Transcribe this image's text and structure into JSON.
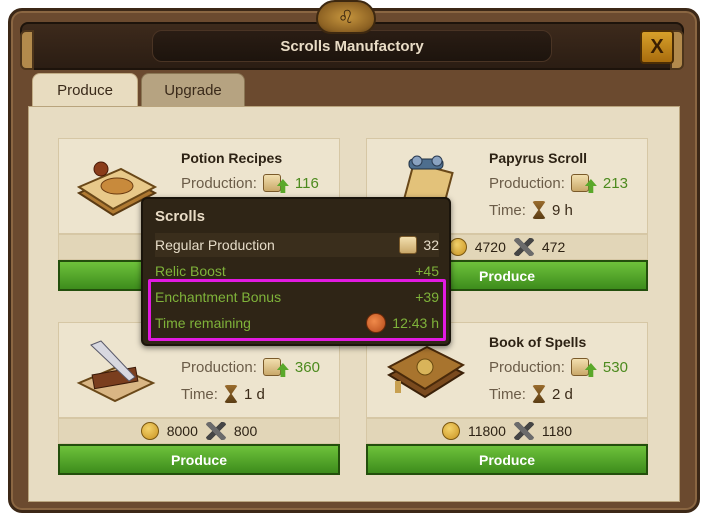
{
  "window": {
    "title": "Scrolls Manufactory",
    "close_label": "X"
  },
  "tabs": [
    {
      "label": "Produce",
      "active": true
    },
    {
      "label": "Upgrade",
      "active": false
    }
  ],
  "labels": {
    "production": "Production:",
    "time": "Time:",
    "produce": "Produce"
  },
  "products": [
    {
      "name": "Potion Recipes",
      "production": "116",
      "time": "",
      "coins": "",
      "supplies": "",
      "icon": "potion-recipes-icon"
    },
    {
      "name": "Papyrus Scroll",
      "production": "213",
      "time": "9 h",
      "coins": "4720",
      "supplies": "472",
      "icon": "papyrus-scroll-icon"
    },
    {
      "name": "",
      "production": "360",
      "time": "1 d",
      "coins": "8000",
      "supplies": "800",
      "icon": "quill-scroll-icon"
    },
    {
      "name": "Book of Spells",
      "production": "530",
      "time": "2 d",
      "coins": "11800",
      "supplies": "1180",
      "icon": "book-of-spells-icon"
    }
  ],
  "tooltip": {
    "title": "Scrolls",
    "rows": [
      {
        "label": "Regular Production",
        "value": "32"
      },
      {
        "label": "Relic Boost",
        "value": "+45"
      },
      {
        "label": "Enchantment Bonus",
        "value": "+39"
      },
      {
        "label": "Time remaining",
        "value": "12:43 h"
      }
    ]
  },
  "colors": {
    "highlight": "#e21ae0",
    "produce_button": "#4ea22a",
    "bonus_text": "#7fb33a"
  }
}
